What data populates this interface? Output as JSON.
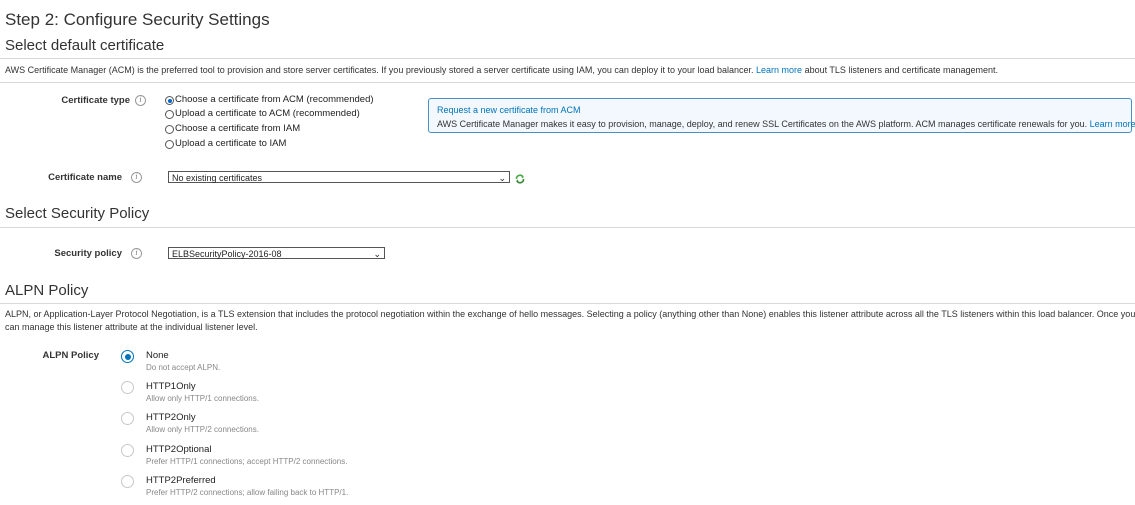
{
  "step_title": "Step 2: Configure Security Settings",
  "cert_section": {
    "heading": "Select default certificate",
    "desc_prefix": "AWS Certificate Manager (ACM) is the preferred tool to provision and store server certificates. If you previously stored a server certificate using IAM, you can deploy it to your load balancer.",
    "desc_link": "Learn more",
    "desc_suffix": "about TLS listeners and certificate management."
  },
  "certificate_type": {
    "label": "Certificate type",
    "options": [
      {
        "label": "Choose a certificate from ACM (recommended)",
        "selected": true
      },
      {
        "label": "Upload a certificate to ACM (recommended)",
        "selected": false
      },
      {
        "label": "Choose a certificate from IAM",
        "selected": false
      },
      {
        "label": "Upload a certificate to IAM",
        "selected": false
      }
    ]
  },
  "acm_box": {
    "title": "Request a new certificate from ACM",
    "text": "AWS Certificate Manager makes it easy to provision, manage, deploy, and renew SSL Certificates on the AWS platform. ACM manages certificate renewals for you.",
    "link": "Learn more"
  },
  "certificate_name": {
    "label": "Certificate name",
    "value": "No existing certificates"
  },
  "security_section": {
    "heading": "Select Security Policy",
    "label": "Security policy",
    "value": "ELBSecurityPolicy-2016-08"
  },
  "alpn_section": {
    "heading": "ALPN Policy",
    "desc_line1": "ALPN, or Application-Layer Protocol Negotiation, is a TLS extension that includes the protocol negotiation within the exchange of hello messages. Selecting a policy (anything other than None) enables this listener attribute across all the TLS listeners within this load balancer. Once your l",
    "desc_line2": "can manage this listener attribute at the individual listener level.",
    "label": "ALPN Policy",
    "options": [
      {
        "name": "None",
        "sub": "Do not accept ALPN.",
        "selected": true
      },
      {
        "name": "HTTP1Only",
        "sub": "Allow only HTTP/1 connections.",
        "selected": false
      },
      {
        "name": "HTTP2Only",
        "sub": "Allow only HTTP/2 connections.",
        "selected": false
      },
      {
        "name": "HTTP2Optional",
        "sub": "Prefer HTTP/1 connections; accept HTTP/2 connections.",
        "selected": false
      },
      {
        "name": "HTTP2Preferred",
        "sub": "Prefer HTTP/2 connections; allow failing back to HTTP/1.",
        "selected": false
      }
    ]
  },
  "icons": {
    "info": "info-icon",
    "refresh": "refresh-icon",
    "dropdown": "chevron-down-icon"
  },
  "colors": {
    "link": "#0073bb",
    "info_box_border": "#4a90c8",
    "radio_selected": "#0073bb"
  }
}
